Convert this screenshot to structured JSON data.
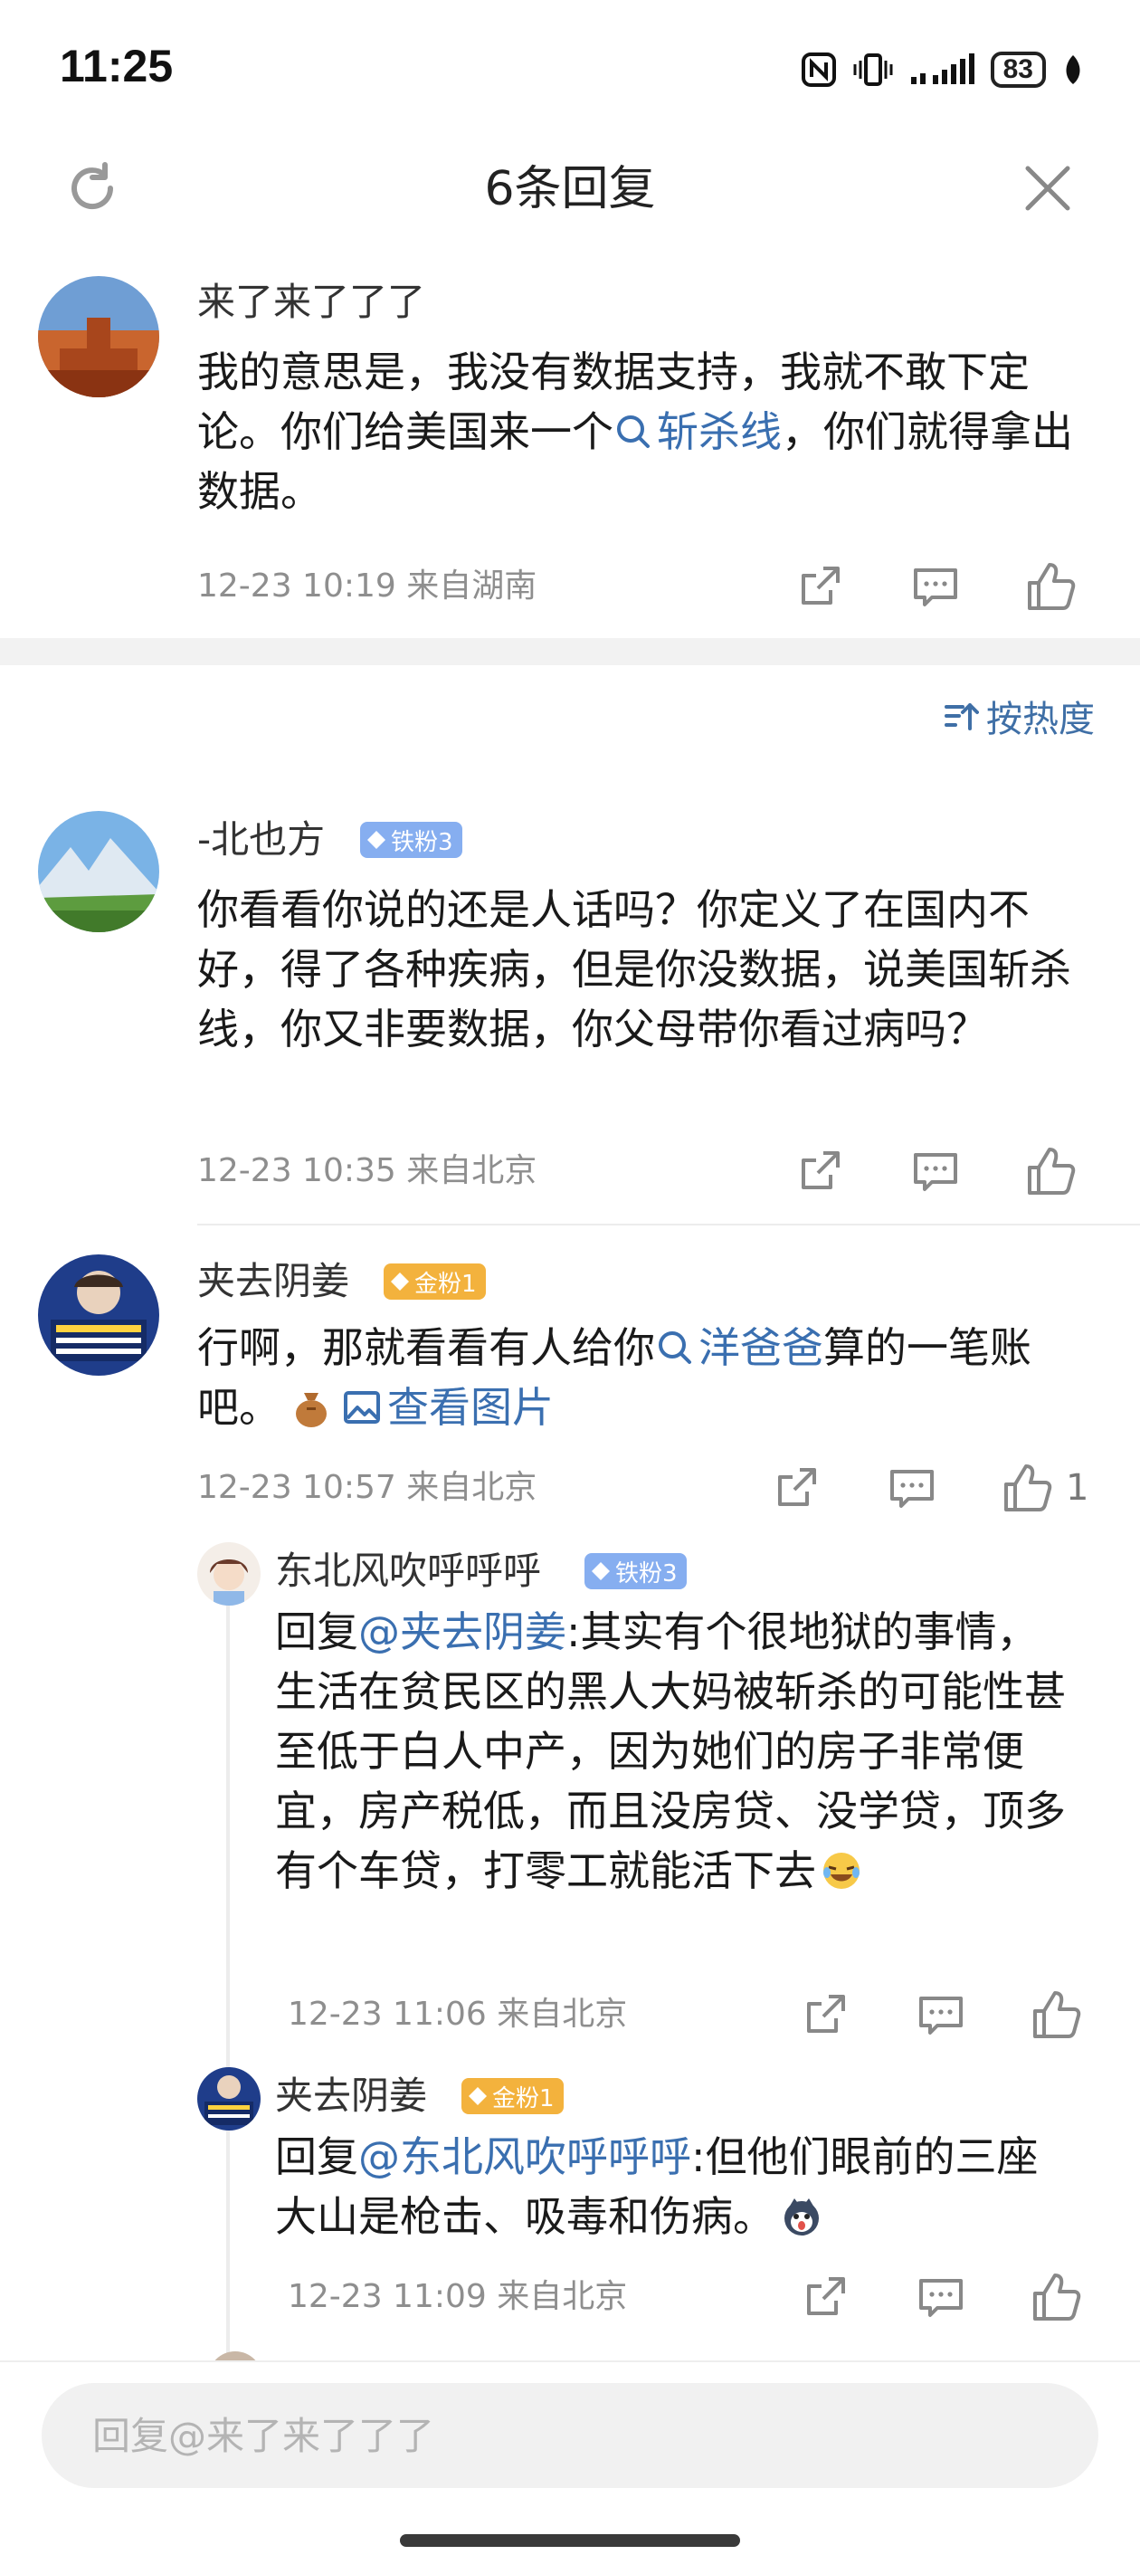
{
  "status_bar": {
    "time": "11:25",
    "battery": "83"
  },
  "header": {
    "title": "6条回复"
  },
  "root_comment": {
    "username": "来了来了了了",
    "text_before": "我的意思是，我没有数据支持，我就不敢下定论。你们给美国来一个",
    "topic": "斩杀线",
    "text_after": "，你们就得拿出数据。",
    "meta": "12-23 10:19 来自湖南"
  },
  "sort": {
    "label": "按热度"
  },
  "replies": [
    {
      "username": "-北也方",
      "badge": "铁粉3",
      "text": "你看看你说的还是人话吗？你定义了在国内不好，得了各种疾病，但是你没数据，说美国斩杀线，你又非要数据，你父母带你看过病吗？",
      "meta": "12-23 10:35 来自北京"
    },
    {
      "username": "夹去阴姜",
      "badge": "金粉1",
      "text_before": "行啊，那就看看有人给你",
      "topic": "洋爸爸",
      "text_after": "算的一笔账吧。",
      "image_link": "查看图片",
      "meta": "12-23 10:57 来自北京",
      "likes": "1"
    }
  ],
  "sub_replies": [
    {
      "username": "东北风吹呼呼呼",
      "badge": "铁粉3",
      "reply_prefix": "回复",
      "mention": "@夹去阴姜",
      "text": ":其实有个很地狱的事情，生活在贫民区的黑人大妈被斩杀的可能性甚至低于白人中产，因为她们的房子非常便宜，房产税低，而且没房贷、没学贷，顶多有个车贷，打零工就能活下去",
      "meta": "12-23 11:06 来自北京"
    },
    {
      "username": "夹去阴姜",
      "badge": "金粉1",
      "reply_prefix": "回复",
      "mention": "@东北风吹呼呼呼",
      "text": ":但他们眼前的三座大山是枪击、吸毒和伤病。",
      "meta": "12-23 11:09 来自北京"
    }
  ],
  "bottom": {
    "placeholder": "回复@来了来了了了"
  }
}
